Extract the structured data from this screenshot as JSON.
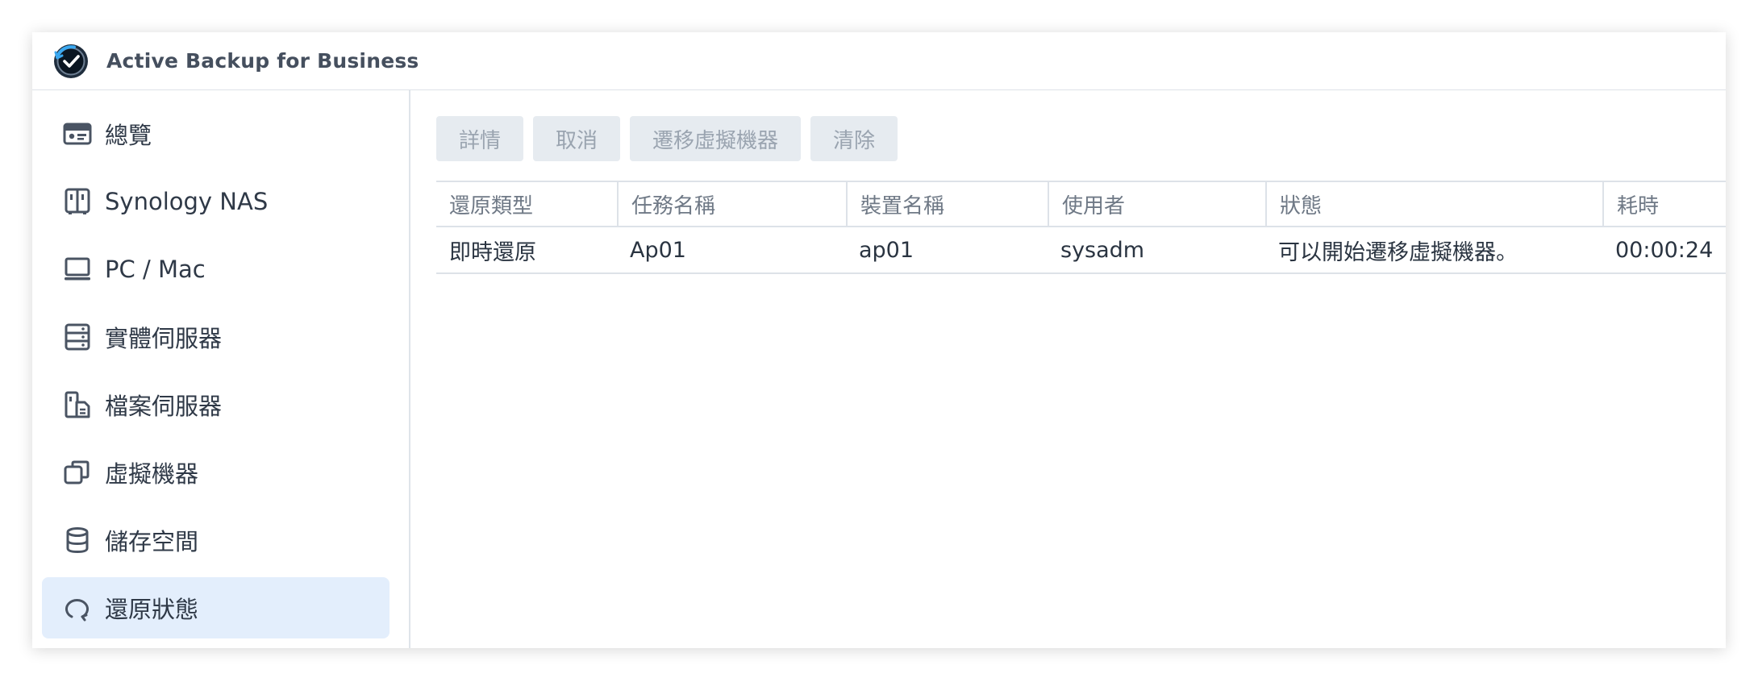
{
  "app": {
    "title": "Active Backup for Business"
  },
  "sidebar": {
    "items": [
      {
        "label": "總覽",
        "icon": "overview-card-icon",
        "active": false
      },
      {
        "label": "Synology NAS",
        "icon": "nas-icon",
        "active": false
      },
      {
        "label": "PC / Mac",
        "icon": "monitor-icon",
        "active": false
      },
      {
        "label": "實體伺服器",
        "icon": "server-rack-icon",
        "active": false
      },
      {
        "label": "檔案伺服器",
        "icon": "file-server-icon",
        "active": false
      },
      {
        "label": "虛擬機器",
        "icon": "virtual-machine-icon",
        "active": false
      },
      {
        "label": "儲存空間",
        "icon": "storage-database-icon",
        "active": false
      },
      {
        "label": "還原狀態",
        "icon": "restore-status-icon",
        "active": true
      }
    ]
  },
  "toolbar": {
    "details_label": "詳情",
    "cancel_label": "取消",
    "migrate_label": "遷移虛擬機器",
    "clear_label": "清除"
  },
  "table": {
    "columns": [
      "還原類型",
      "任務名稱",
      "裝置名稱",
      "使用者",
      "狀態",
      "耗時"
    ],
    "rows": [
      [
        "即時還原",
        "Ap01",
        "ap01",
        "sysadm",
        "可以開始遷移虛擬機器。",
        "00:00:24"
      ]
    ]
  },
  "colors": {
    "accent_active_bg": "#e3eefc",
    "button_bg": "#e6ebf0",
    "button_text_disabled": "#9aa4b0"
  }
}
